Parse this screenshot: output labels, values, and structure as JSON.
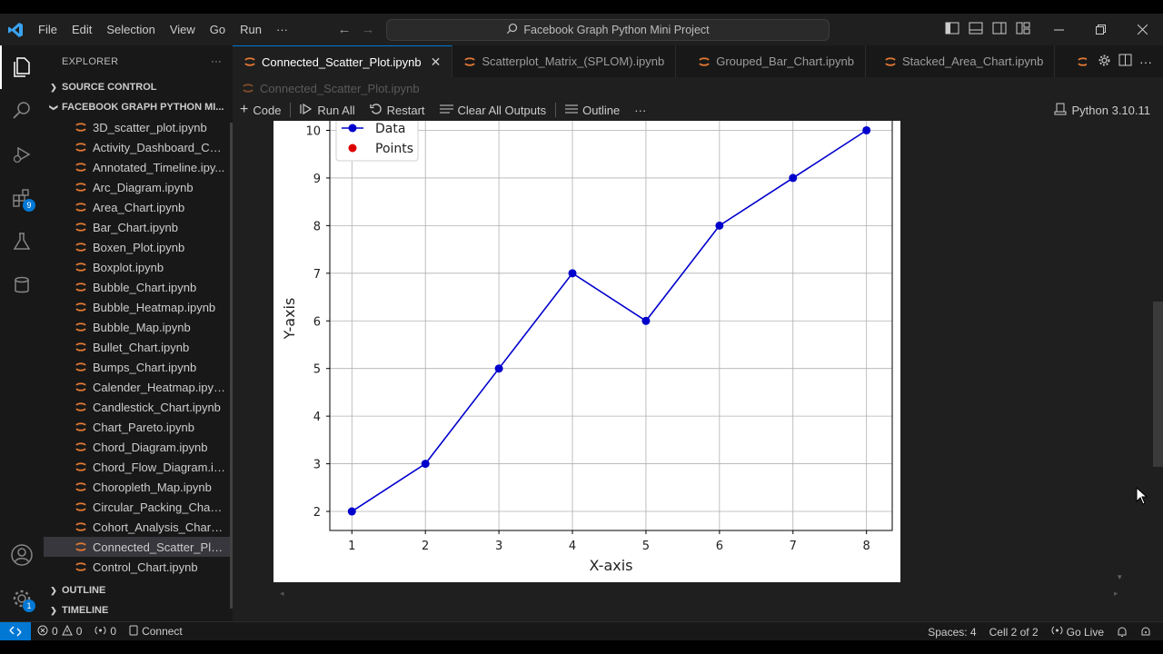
{
  "titlebar": {
    "menu": [
      "File",
      "Edit",
      "Selection",
      "View",
      "Go",
      "Run",
      "···"
    ],
    "search_text": "Facebook Graph Python Mini Project"
  },
  "activitybar": {
    "extensions_badge": "9",
    "settings_badge": "1"
  },
  "sidebar": {
    "header": "EXPLORER",
    "more": "···",
    "source_control": "SOURCE CONTROL",
    "project": "FACEBOOK GRAPH PYTHON MI...",
    "files": [
      "3D_scatter_plot.ipynb",
      "Activity_Dashboard_Ch...",
      "Annotated_Timeline.ipy...",
      "Arc_Diagram.ipynb",
      "Area_Chart.ipynb",
      "Bar_Chart.ipynb",
      "Boxen_Plot.ipynb",
      "Boxplot.ipynb",
      "Bubble_Chart.ipynb",
      "Bubble_Heatmap.ipynb",
      "Bubble_Map.ipynb",
      "Bullet_Chart.ipynb",
      "Bumps_Chart.ipynb",
      "Calender_Heatmap.ipynb",
      "Candlestick_Chart.ipynb",
      "Chart_Pareto.ipynb",
      "Chord_Diagram.ipynb",
      "Chord_Flow_Diagram.ip...",
      "Choropleth_Map.ipynb",
      "Circular_Packing_Chart.i...",
      "Cohort_Analysis_Chart.i...",
      "Connected_Scatter_Plot...",
      "Control_Chart.ipynb"
    ],
    "selected_index": 21,
    "outline": "OUTLINE",
    "timeline": "TIMELINE"
  },
  "tabs": [
    {
      "label": "Connected_Scatter_Plot.ipynb",
      "active": true
    },
    {
      "label": "Scatterplot_Matrix_(SPLOM).ipynb",
      "active": false
    },
    {
      "label": "Grouped_Bar_Chart.ipynb",
      "active": false
    },
    {
      "label": "Stacked_Area_Chart.ipynb",
      "active": false
    },
    {
      "label": "Bu",
      "active": false
    }
  ],
  "breadcrumb": "Connected_Scatter_Plot.ipynb",
  "toolbar": {
    "code": "Code",
    "run_all": "Run All",
    "restart": "Restart",
    "clear": "Clear All Outputs",
    "outline": "Outline",
    "more": "···",
    "kernel": "Python 3.10.11"
  },
  "chart_data": {
    "type": "line",
    "x": [
      1,
      2,
      3,
      4,
      5,
      6,
      7,
      8
    ],
    "series": [
      {
        "name": "Data",
        "values": [
          2,
          3,
          5,
          7,
          6,
          8,
          9,
          10
        ],
        "color": "#0000cc",
        "marker": "o"
      }
    ],
    "extra_legend": [
      {
        "name": "Points",
        "color": "#dd0000"
      }
    ],
    "xlabel": "X-axis",
    "ylabel": "Y-axis",
    "xlim": [
      0.7,
      8.35
    ],
    "ylim": [
      1.6,
      10.2
    ],
    "xticks": [
      1,
      2,
      3,
      4,
      5,
      6,
      7,
      8
    ],
    "yticks": [
      2,
      3,
      4,
      5,
      6,
      7,
      8,
      9,
      10
    ],
    "grid": true,
    "legend_position": "upper-left"
  },
  "statusbar": {
    "errors": "0",
    "warnings": "0",
    "ports": "0",
    "connect": "Connect",
    "spaces": "Spaces: 4",
    "cell": "Cell 2 of 2",
    "golive": "Go Live"
  },
  "colors": {
    "accent": "#0078d4",
    "notebook_icon": "#e37933",
    "line": "#0000cc",
    "points": "#dd0000"
  }
}
